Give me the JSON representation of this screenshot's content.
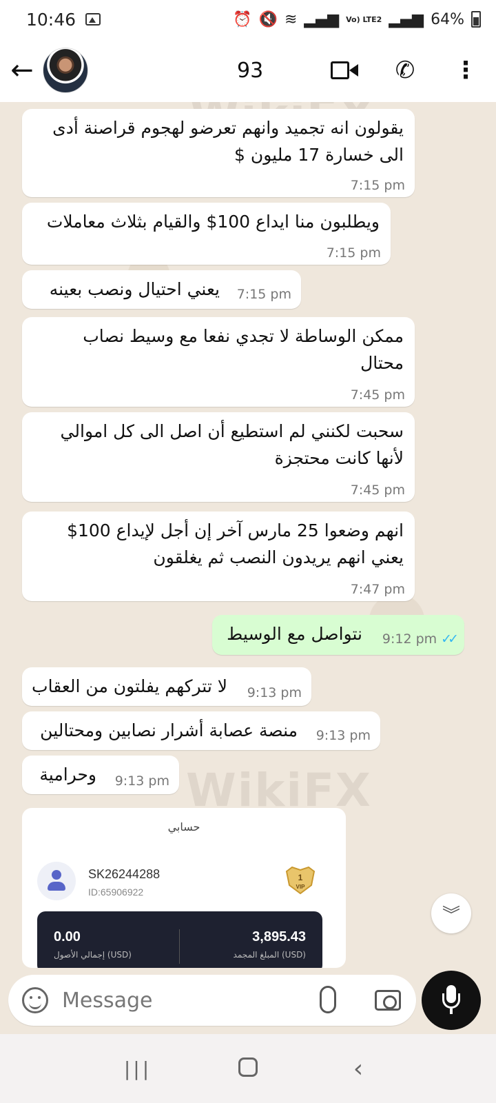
{
  "status_bar": {
    "time": "10:46",
    "network_label": "Vo) LTE2",
    "battery_percent": "64%"
  },
  "header": {
    "contact_name": "93"
  },
  "messages": [
    {
      "direction": "in",
      "text": "يقولون انه تجميد وانهم تعرضو لهجوم قراصنة أدى\nالى خسارة 17 مليون $",
      "time": "7:15 pm"
    },
    {
      "direction": "in",
      "text": "ويطلبون منا ايداع 100$ والقيام بثلاث معاملات",
      "time": "7:15 pm"
    },
    {
      "direction": "in",
      "text": "يعني احتيال ونصب بعينه",
      "time": "7:15 pm"
    },
    {
      "direction": "in",
      "text": "ممكن الوساطة لا تجدي نفعا مع وسيط نصاب\nمحتال",
      "time": "7:45 pm"
    },
    {
      "direction": "in",
      "text": "سحبت لكنني لم استطيع أن اصل الى كل اموالي\nلأنها كانت محتجزة",
      "time": "7:45 pm"
    },
    {
      "direction": "in",
      "text": "انهم وضعوا 25 مارس آخر إن أجل لإيداع 100$\nيعني انهم يريدون النصب ثم يغلقون",
      "time": "7:47 pm"
    },
    {
      "direction": "out",
      "text": "نتواصل مع الوسيط",
      "time": "9:12 pm",
      "read": true
    },
    {
      "direction": "in",
      "text": "لا تتركهم يفلتون من العقاب",
      "time": "9:13 pm"
    },
    {
      "direction": "in",
      "text": "منصة عصابة أشرار نصابين ومحتالين",
      "time": "9:13 pm"
    },
    {
      "direction": "in",
      "text": "وحرامية",
      "time": "9:13 pm"
    }
  ],
  "image_card": {
    "title": "حسابي",
    "account_name": "SK26244288",
    "account_id": "ID:65906922",
    "vip_badge": "VIP",
    "vip_level": "1",
    "total_assets_value": "0.00",
    "total_assets_label": "إجمالي الأصول (USD)",
    "frozen_value": "3,895.43",
    "frozen_label": "المبلغ المجمد (USD)"
  },
  "watermark": "WikiFX",
  "input": {
    "placeholder": "Message"
  },
  "icons": {
    "back": "arrow-left-icon",
    "video": "video-call-icon",
    "phone": "phone-call-icon",
    "more": "more-vertical-icon",
    "emoji": "sticker-icon",
    "attach": "paperclip-icon",
    "camera": "camera-icon",
    "mic": "microphone-icon",
    "scroll": "double-chevron-down-icon"
  },
  "colors": {
    "incoming_bubble": "#ffffff",
    "outgoing_bubble": "#d8fdd2",
    "chat_background": "#efe7dc",
    "read_ticks": "#34b7f1"
  }
}
